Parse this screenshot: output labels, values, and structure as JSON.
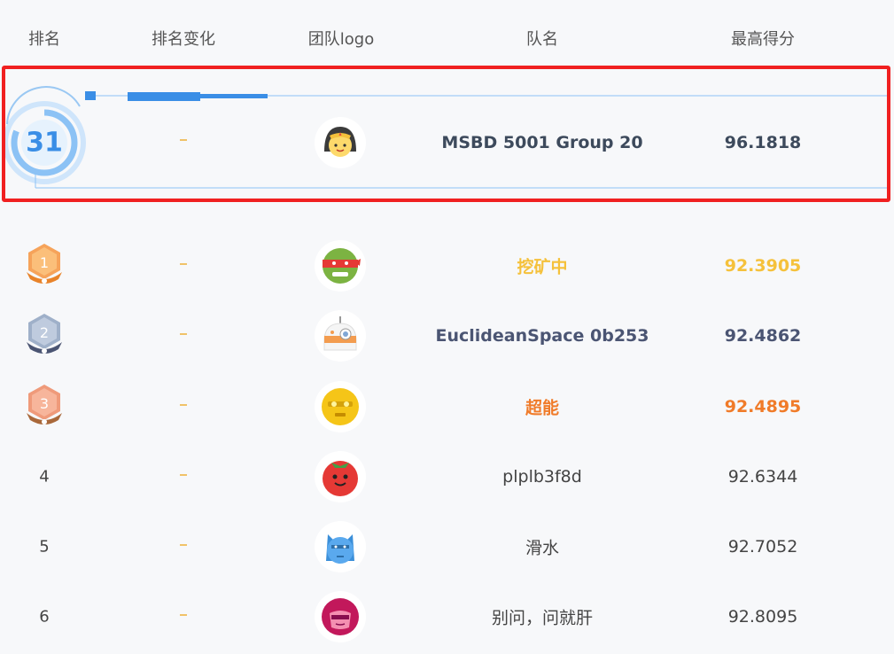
{
  "headers": {
    "rank": "排名",
    "rank_change": "排名变化",
    "team_logo": "团队logo",
    "team_name": "队名",
    "best_score": "最高得分"
  },
  "my_team": {
    "rank": "31",
    "name": "MSBD 5001 Group 20",
    "score": "96.1818",
    "avatar_icon": "wonder-woman-avatar-icon",
    "highlight_color": "#f02020"
  },
  "rows": [
    {
      "rank": "1",
      "badge": "gold-medal-icon",
      "name": "挖矿中",
      "score": "92.3905",
      "avatar_icon": "ninja-turtle-avatar-icon",
      "color": "#f5c13b"
    },
    {
      "rank": "2",
      "badge": "silver-medal-icon",
      "name": "EuclideanSpace 0b253",
      "score": "92.4862",
      "avatar_icon": "droid-avatar-icon",
      "color": "#4b5573"
    },
    {
      "rank": "3",
      "badge": "bronze-medal-icon",
      "name": "超能",
      "score": "92.4895",
      "avatar_icon": "gold-robot-avatar-icon",
      "color": "#f07b29"
    },
    {
      "rank": "4",
      "name": "plplb3f8d",
      "score": "92.6344",
      "avatar_icon": "tomato-face-avatar-icon"
    },
    {
      "rank": "5",
      "name": "滑水",
      "score": "92.7052",
      "avatar_icon": "blue-creature-avatar-icon"
    },
    {
      "rank": "6",
      "name": "别问，问就肝",
      "score": "92.8095",
      "avatar_icon": "helmet-hero-avatar-icon"
    }
  ],
  "rank_change_symbol": "—"
}
